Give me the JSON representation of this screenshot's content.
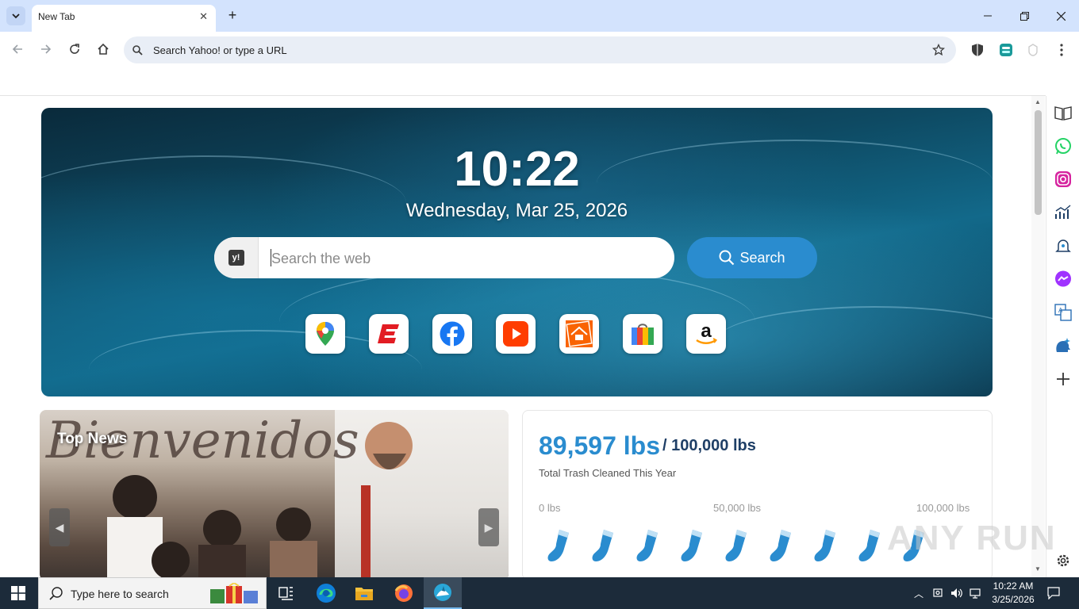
{
  "browser": {
    "tab_title": "New Tab",
    "omnibox_placeholder": "Search Yahoo! or type a URL"
  },
  "hero": {
    "time": "10:22",
    "date": "Wednesday, Mar 25, 2026",
    "search_placeholder": "Search the web",
    "search_button": "Search",
    "shortcuts": [
      "google-maps",
      "espn",
      "facebook",
      "youtube",
      "the-home-depot",
      "shopping",
      "amazon"
    ]
  },
  "news": {
    "title": "Top News",
    "image_script_text": "Bienvenidos"
  },
  "trash": {
    "amount": "89,597 lbs",
    "goal": "/ 100,000 lbs",
    "subtitle": "Total Trash Cleaned This Year",
    "scale": [
      "0 lbs",
      "50,000 lbs",
      "100,000 lbs"
    ],
    "progress_fraction": 0.896
  },
  "taskbar": {
    "search_text": "Type here to search",
    "time": "10:22 AM",
    "date": "3/25/2026"
  },
  "watermark": "ANY RUN",
  "colors": {
    "accent_blue": "#2a8ccf",
    "tabstrip": "#d3e3fd",
    "taskbar": "#1c2b3a"
  }
}
